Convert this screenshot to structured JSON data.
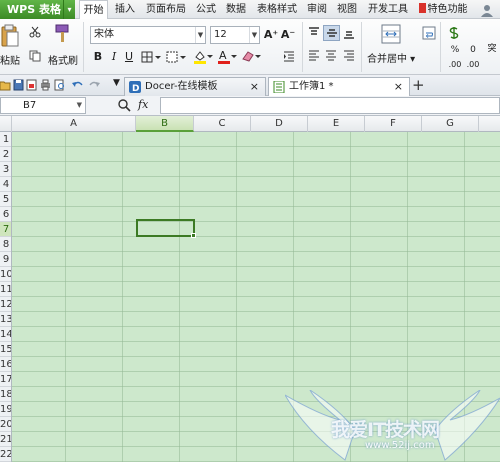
{
  "app": {
    "title": "WPS 表格"
  },
  "menu": [
    "开始",
    "插入",
    "页面布局",
    "公式",
    "数据",
    "表格样式",
    "审阅",
    "视图",
    "开发工具",
    "特色功能"
  ],
  "ribbon": {
    "paste_label": "粘贴",
    "format_painter_label": "格式刷",
    "font_name": "宋体",
    "font_size": "12",
    "merge_label": "合并居中",
    "increase_font": "A⁺",
    "decrease_font": "A⁻"
  },
  "doc_tabs": [
    {
      "label": "Docer-在线模板"
    },
    {
      "label": "工作簿1 *"
    }
  ],
  "formula_bar": {
    "name_box": "B7",
    "fx": "fx",
    "value": ""
  },
  "columns": [
    "A",
    "B",
    "C",
    "D",
    "E",
    "F",
    "G"
  ],
  "selected_column": "B",
  "rows": [
    "1",
    "2",
    "3",
    "4",
    "5",
    "6",
    "7",
    "8",
    "9",
    "10",
    "11",
    "12",
    "13",
    "14",
    "15",
    "16",
    "17",
    "18",
    "19",
    "20",
    "21",
    "22"
  ],
  "selected_row": "7",
  "active_cell": "B7",
  "watermark": {
    "text": "我爱IT技术网",
    "url": "www.52ij.com"
  },
  "colors": {
    "accent": "#3c8b26",
    "grid_bg": "#cde8cc",
    "selection": "#3c7a24"
  }
}
